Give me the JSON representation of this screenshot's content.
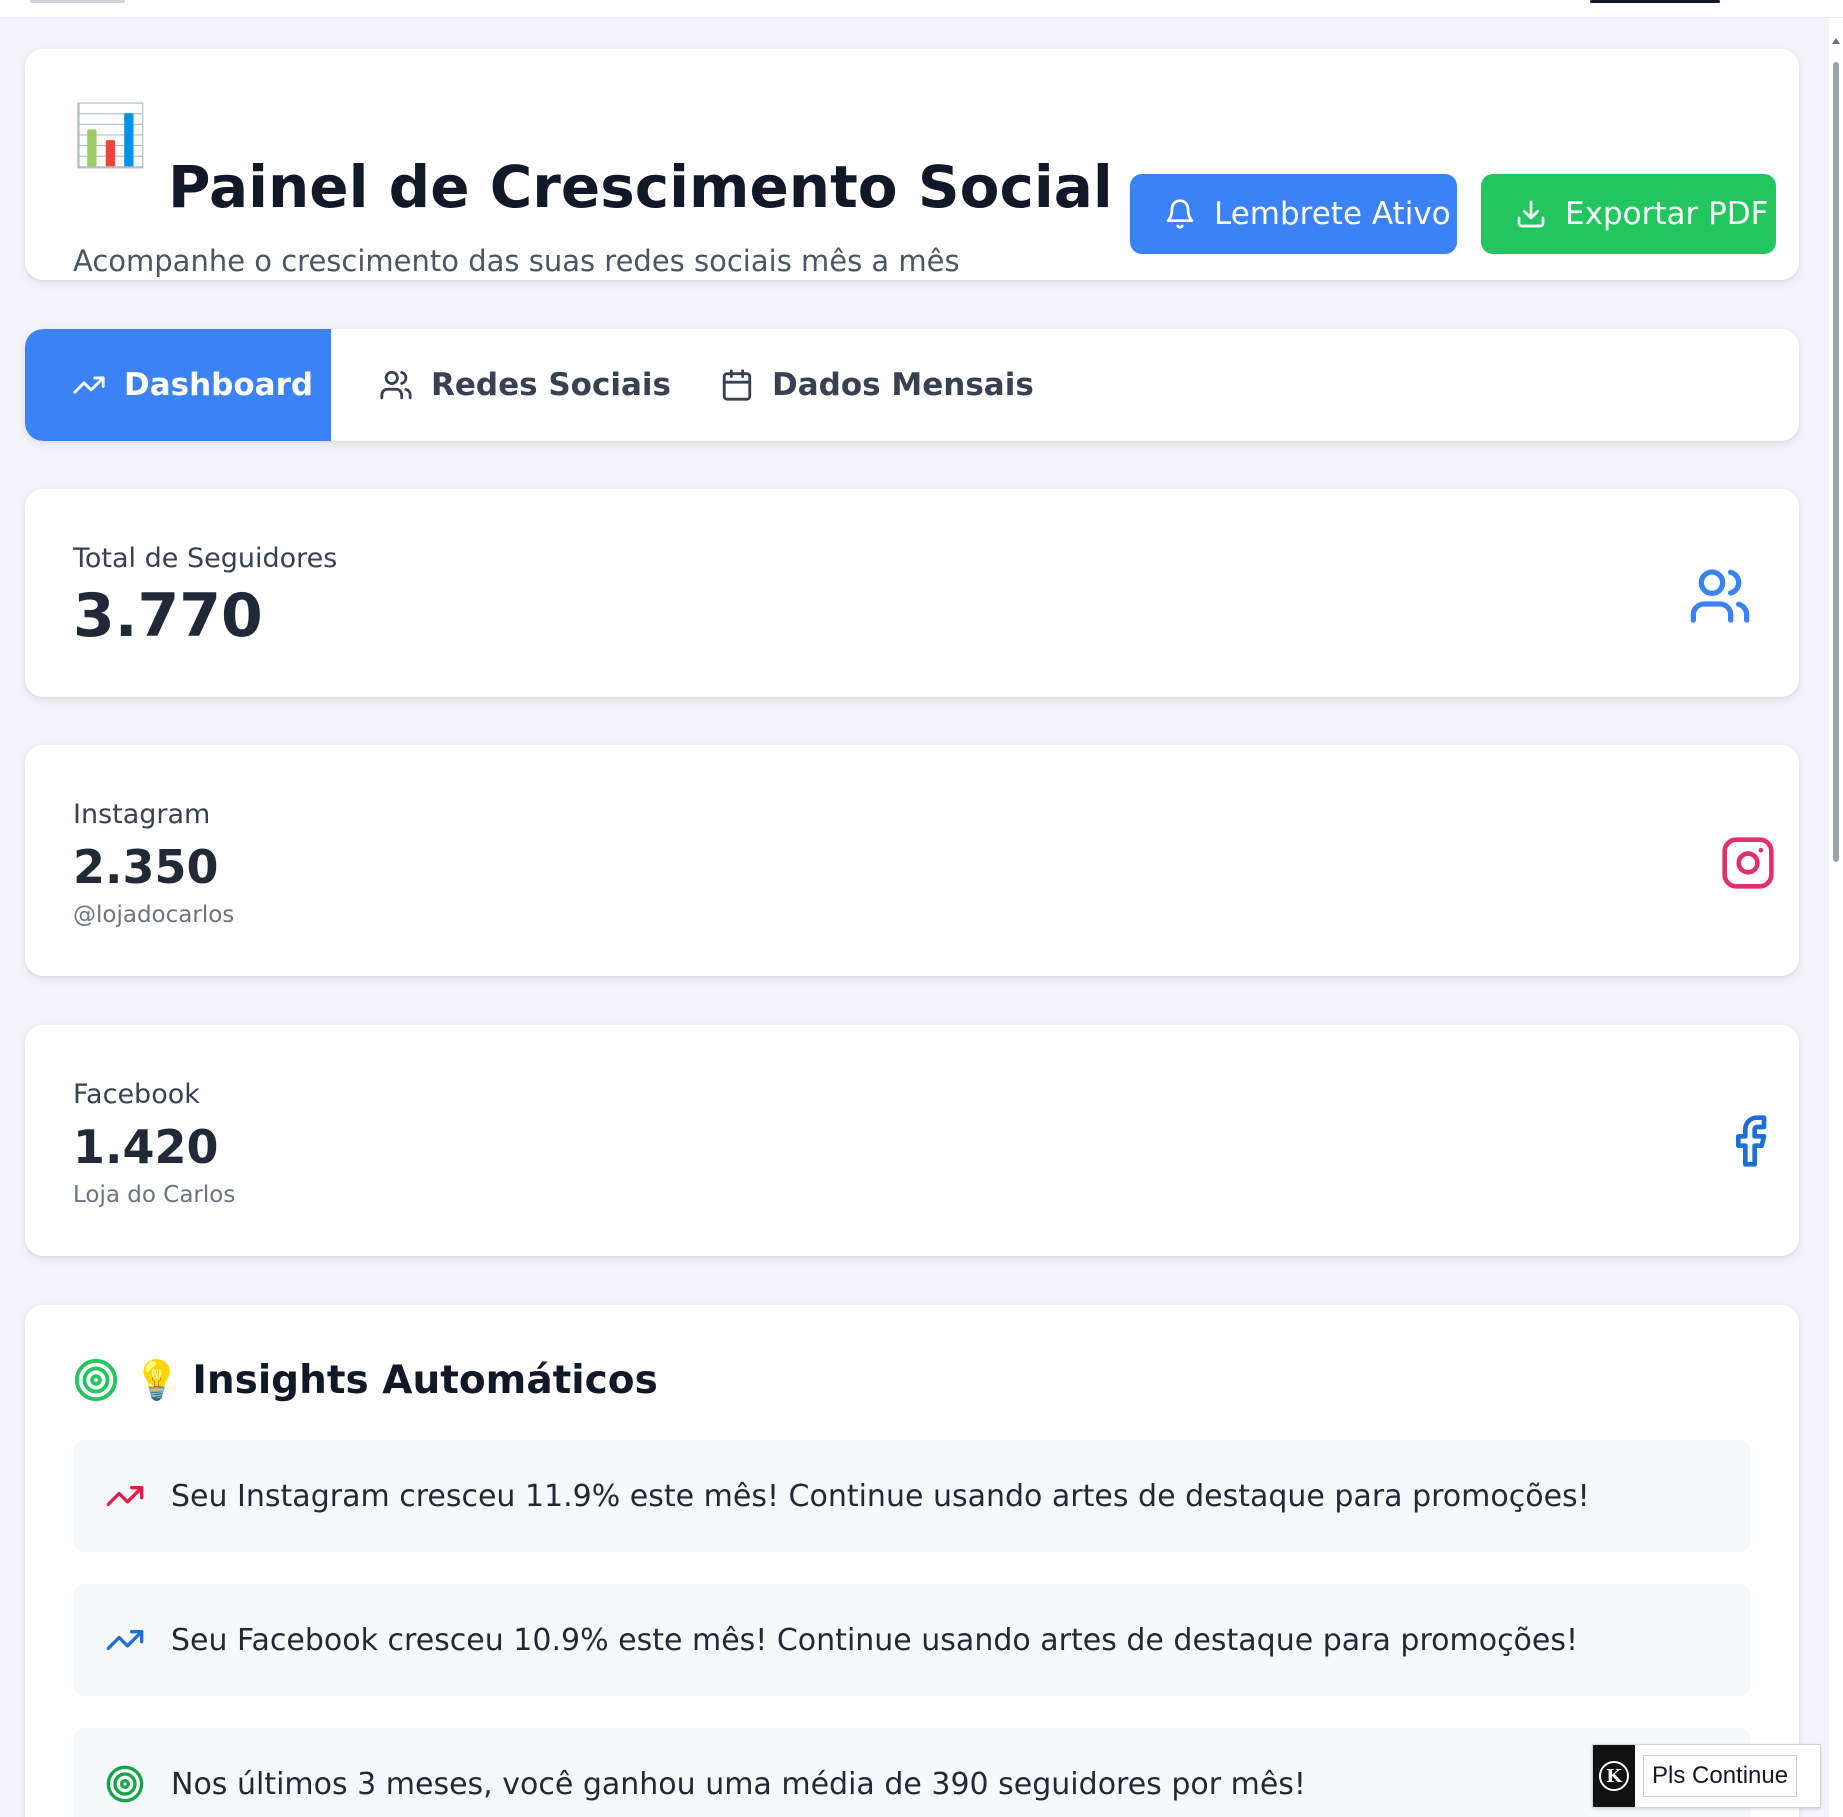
{
  "header": {
    "title_emoji": "📊",
    "title": "Painel de Crescimento Social",
    "subtitle": "Acompanhe o crescimento das suas redes sociais mês a mês",
    "reminder_button": "Lembrete Ativo",
    "export_button": "Exportar PDF"
  },
  "tabs": [
    {
      "label": "Dashboard",
      "icon": "trending-up-icon",
      "active": true
    },
    {
      "label": "Redes Sociais",
      "icon": "users-icon",
      "active": false
    },
    {
      "label": "Dados Mensais",
      "icon": "calendar-icon",
      "active": false
    }
  ],
  "stats": {
    "total": {
      "label": "Total de Seguidores",
      "value": "3.770",
      "icon": "users-icon"
    },
    "instagram": {
      "label": "Instagram",
      "value": "2.350",
      "handle": "@lojadocarlos",
      "icon": "instagram-icon"
    },
    "facebook": {
      "label": "Facebook",
      "value": "1.420",
      "handle": "Loja do Carlos",
      "icon": "facebook-icon"
    }
  },
  "insights": {
    "heading_emoji": "💡",
    "heading": "Insights Automáticos",
    "items": [
      {
        "text": "Seu Instagram cresceu 11.9% este mês! Continue usando artes de destaque para promoções!",
        "icon": "trending-up-icon",
        "color": "#e11d48"
      },
      {
        "text": "Seu Facebook cresceu 10.9% este mês! Continue usando artes de destaque para promoções!",
        "icon": "trending-up-icon",
        "color": "#1d6fd6"
      },
      {
        "text": "Nos últimos 3 meses, você ganhou uma média de 390 seguidores por mês!",
        "icon": "target-icon",
        "color": "#16a34a"
      }
    ]
  },
  "widget": {
    "label": "Pls Continue",
    "badge": "K"
  },
  "colors": {
    "primary": "#3b82f6",
    "success": "#22c55e",
    "instagram": "#e1306c",
    "facebook": "#1d6fd6",
    "background": "#f5f4fb"
  }
}
